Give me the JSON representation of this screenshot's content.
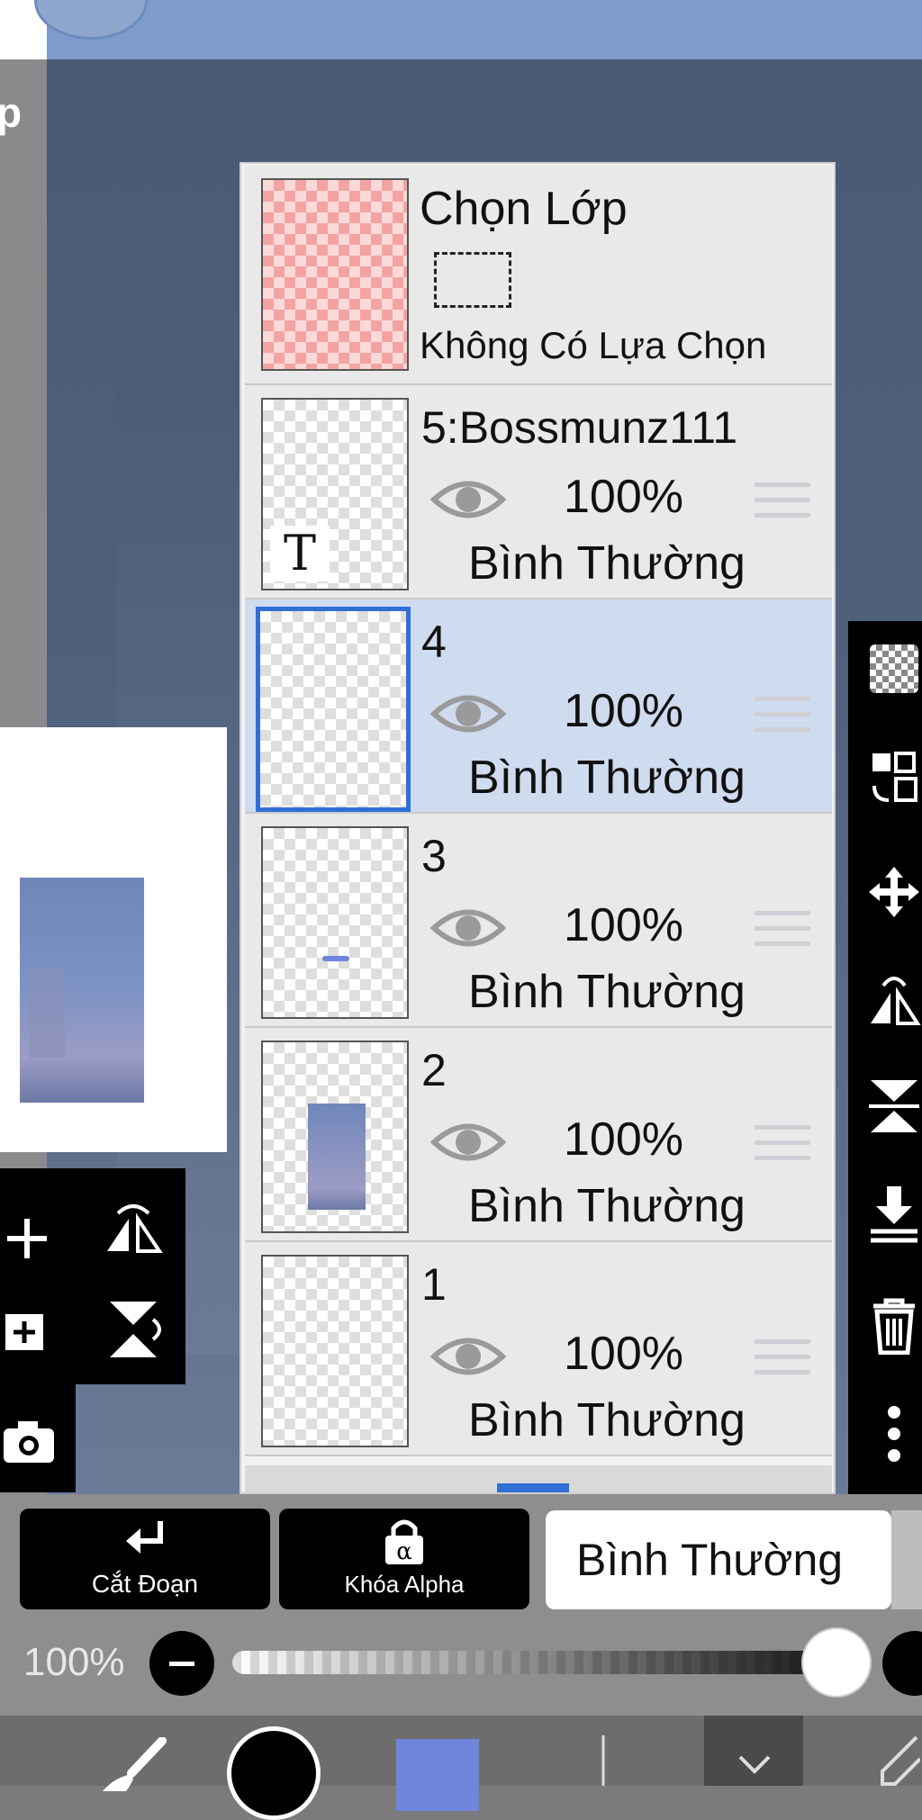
{
  "left_panel": {
    "partial_label": "p"
  },
  "selection_layer": {
    "title": "Chọn Lớp",
    "status": "Không Có Lựa Chọn"
  },
  "layers": [
    {
      "name": "5:Bossmunz111",
      "opacity": "100%",
      "blend": "Bình Thường",
      "type": "text",
      "thumb_glyph": "T",
      "selected": false
    },
    {
      "name": "4",
      "opacity": "100%",
      "blend": "Bình Thường",
      "type": "raster",
      "selected": true
    },
    {
      "name": "3",
      "opacity": "100%",
      "blend": "Bình Thường",
      "type": "raster",
      "selected": false
    },
    {
      "name": "2",
      "opacity": "100%",
      "blend": "Bình Thường",
      "type": "raster",
      "selected": false
    },
    {
      "name": "1",
      "opacity": "100%",
      "blend": "Bình Thường",
      "type": "raster",
      "selected": false
    }
  ],
  "bottom_controls": {
    "clip_label": "Cắt Đoạn",
    "alpha_lock_label": "Khóa Alpha",
    "blend_mode": "Bình Thường",
    "opacity_label": "100%"
  },
  "colors": {
    "selected_layer_bg": "#cfdbee",
    "selected_border": "#2f6fd6",
    "current_color": "#6f85dd"
  }
}
